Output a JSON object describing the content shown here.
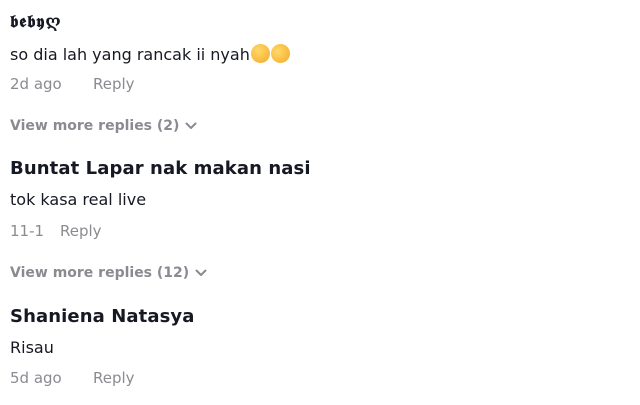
{
  "comments": [
    {
      "username": "𝖇𝖊𝖇𝖞ღ",
      "text": "so dia lah yang rancak ii nyah",
      "emojis": [
        "relieved-face-emoji",
        "rolling-on-floor-laughing-emoji"
      ],
      "time": "2d ago",
      "reply_label": "Reply",
      "view_more": "View more replies (2)"
    },
    {
      "username": "Buntat Lapar nak makan nasi",
      "text": "tok kasa real live",
      "time": "11-1",
      "reply_label": "Reply",
      "view_more": "View more replies (12)"
    },
    {
      "username": "Shaniena Natasya",
      "text": "Risau",
      "time": "5d ago",
      "reply_label": "Reply"
    }
  ],
  "colors": {
    "text_primary": "#161823",
    "text_secondary": "#8a8b91",
    "background": "#ffffff"
  }
}
